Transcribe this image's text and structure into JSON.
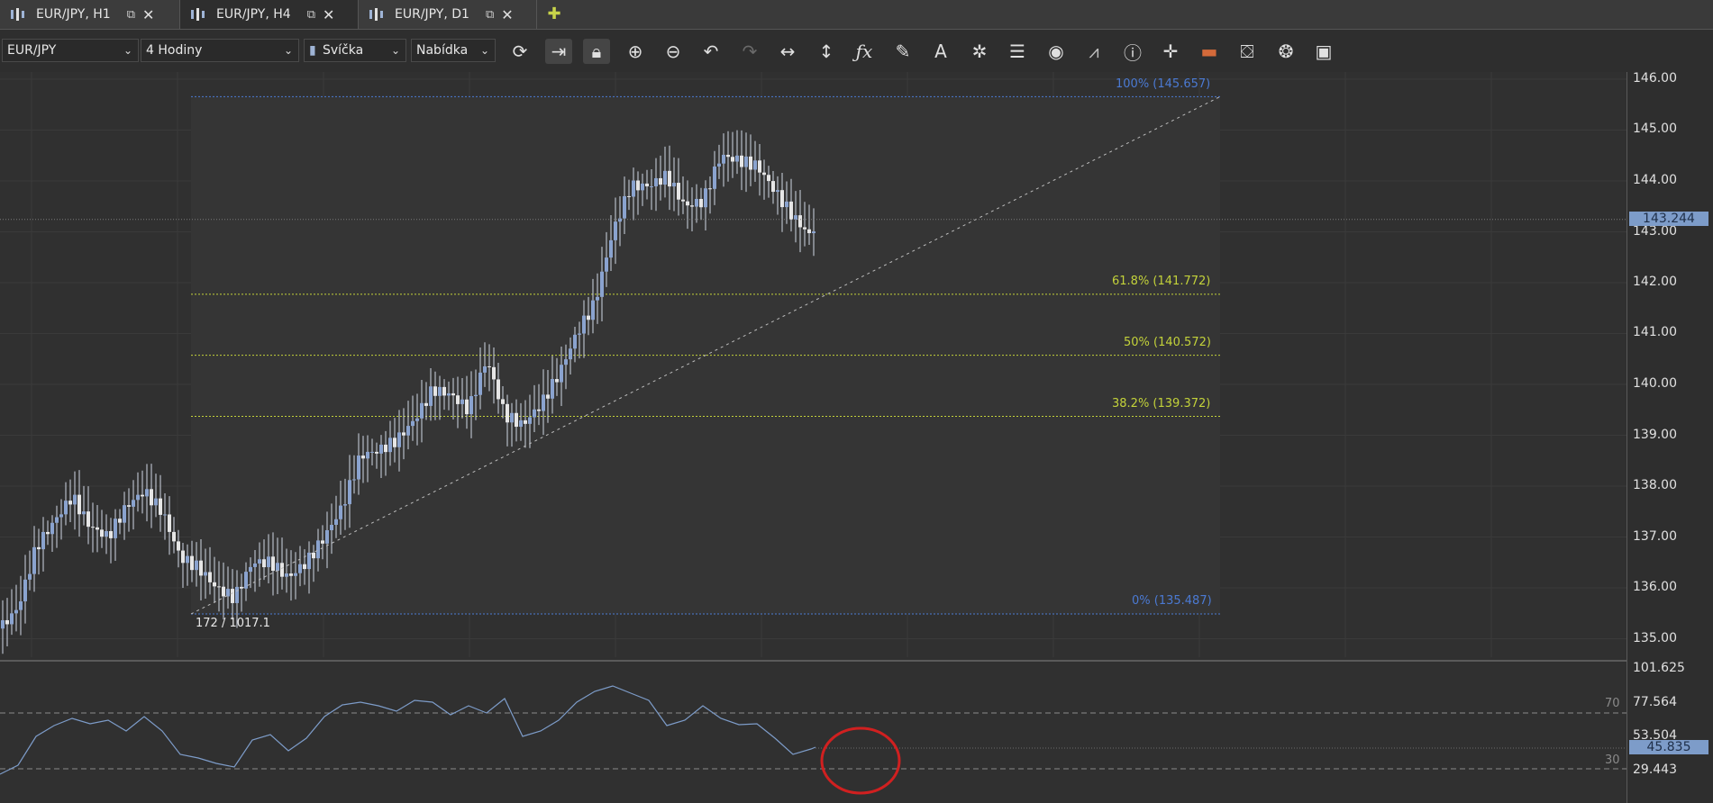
{
  "tabs": [
    {
      "label": "EUR/JPY, H1",
      "active": false
    },
    {
      "label": "EUR/JPY, H4",
      "active": true
    },
    {
      "label": "EUR/JPY, D1",
      "active": false
    }
  ],
  "toolbar": {
    "instrument": "EUR/JPY",
    "period": "4 Hodiny",
    "chart_type": "Svíčka",
    "price_side": "Nabídka",
    "icons": [
      "refresh-icon",
      "auto-scroll-icon",
      "lock-icon",
      "zoom-in-icon",
      "zoom-out-icon",
      "undo-icon",
      "redo-icon",
      "horizontal-resize-icon",
      "vertical-resize-icon",
      "indicator-fx-icon",
      "pencil-icon",
      "text-tool-icon",
      "pattern-icon",
      "layers-icon",
      "eye-icon",
      "alert-icon",
      "info-icon",
      "crosshair-icon",
      "ruler-icon",
      "paint-icon",
      "settings-icon",
      "save-icon"
    ]
  },
  "price_axis": {
    "ticks": [
      "146.00",
      "145.00",
      "144.00",
      "143.00",
      "142.00",
      "141.00",
      "140.00",
      "139.00",
      "138.00",
      "137.00",
      "136.00",
      "135.00"
    ],
    "current_price": "143.244"
  },
  "fibonacci": {
    "levels": [
      {
        "label": "100% (145.657)",
        "color": "#4b7ad3"
      },
      {
        "label": "61.8% (141.772)",
        "color": "#c3d23a"
      },
      {
        "label": "50% (140.572)",
        "color": "#c3d23a"
      },
      {
        "label": "38.2% (139.372)",
        "color": "#c3d23a"
      },
      {
        "label": "0% (135.487)",
        "color": "#4b7ad3"
      }
    ],
    "anchor_caption": "172 / 1017.1"
  },
  "oscillator": {
    "ticks": [
      "101.625",
      "77.564",
      "53.504",
      "29.443"
    ],
    "level_labels": [
      "70",
      "30"
    ],
    "current_value": "45.835"
  },
  "colors": {
    "candle": "#8aa3cf",
    "candle_up": "#e6e6e6",
    "highlight_circle": "#d02020"
  }
}
